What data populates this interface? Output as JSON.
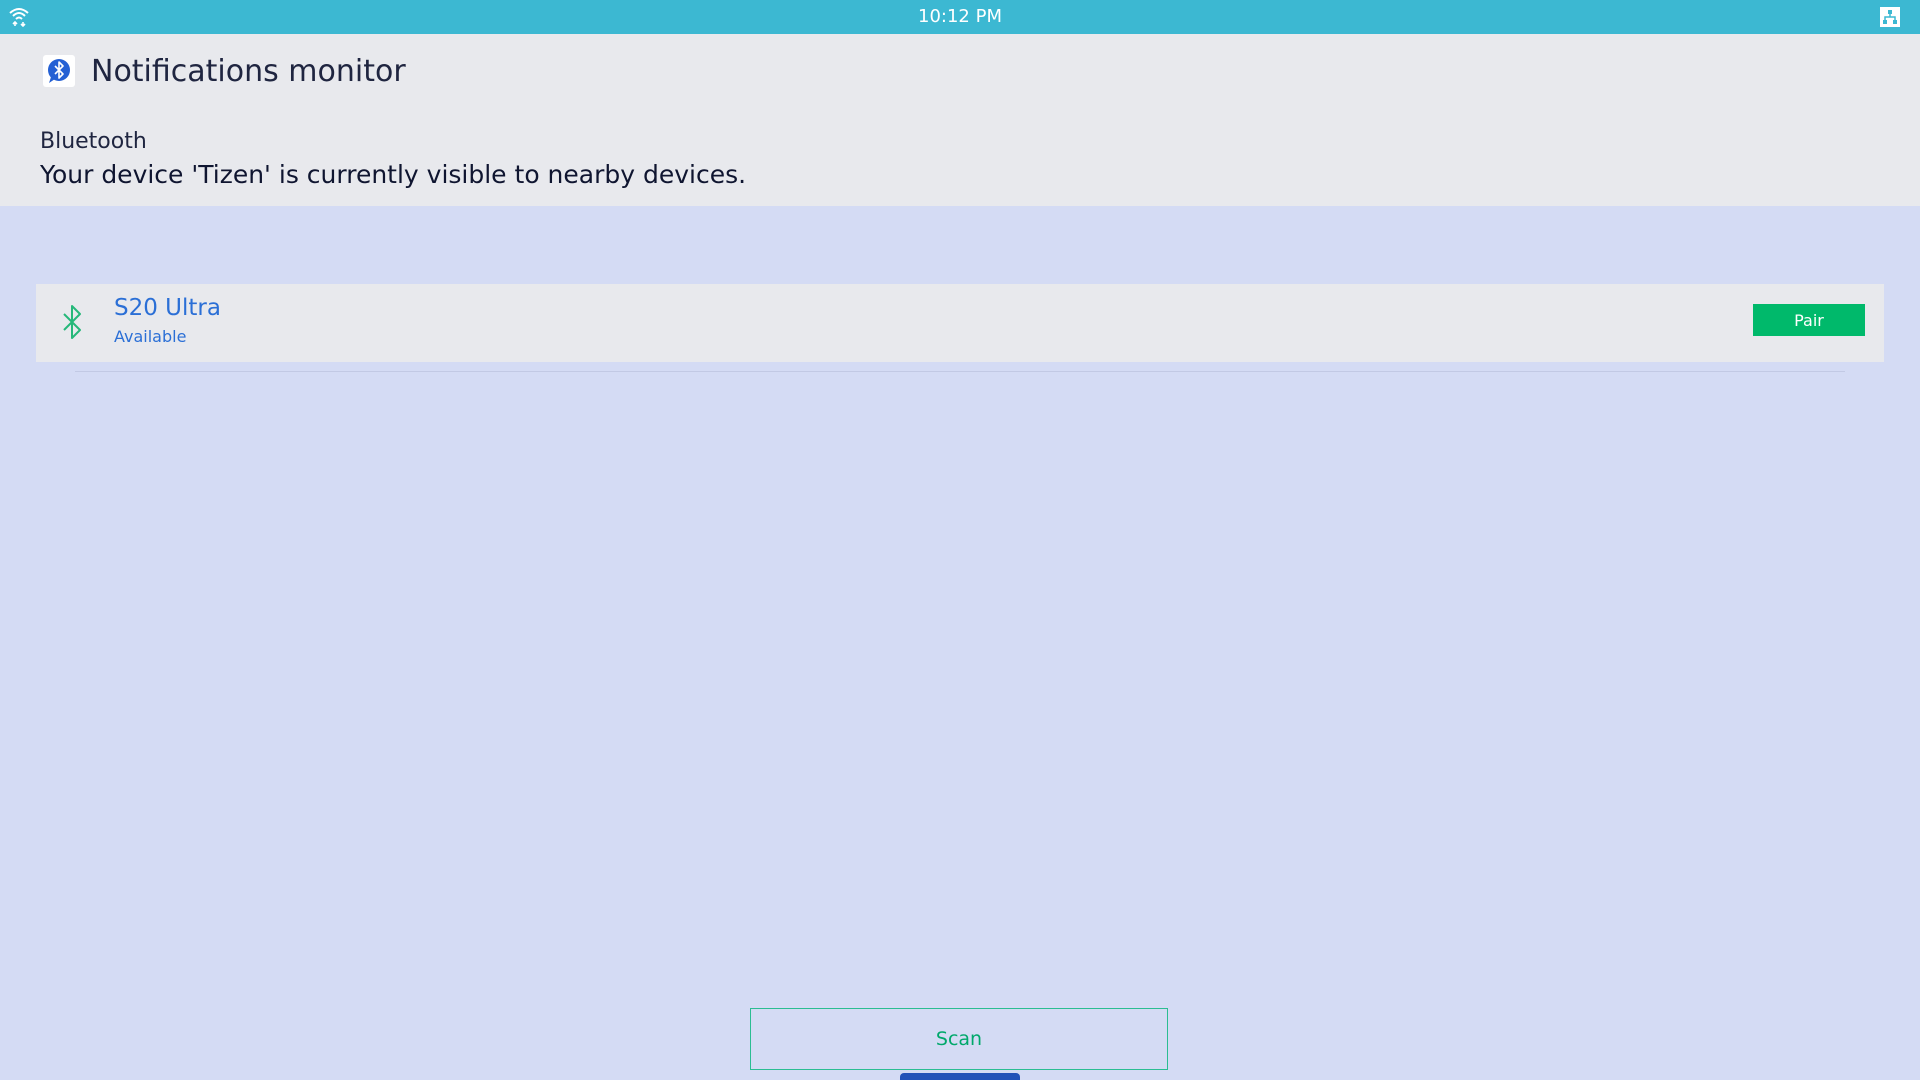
{
  "status_bar": {
    "time": "10:12 PM",
    "left_icon": "wifi-icon",
    "right_icon": "network-icon",
    "color": "#3cb8d2"
  },
  "header": {
    "app_icon": "bluetooth-chat-icon",
    "app_title": "Notifications monitor",
    "section_label": "Bluetooth",
    "visibility_message": "Your device 'Tizen' is currently visible to nearby devices."
  },
  "devices": [
    {
      "icon": "bluetooth-icon",
      "name": "S20 Ultra",
      "status": "Available",
      "action_label": "Pair"
    }
  ],
  "footer": {
    "scan_label": "Scan"
  },
  "colors": {
    "background": "#d4dbf4",
    "panel": "#e8e9ed",
    "accent_green": "#00b96b",
    "link_blue": "#2b6fd6",
    "indicator": "#2152b8"
  }
}
